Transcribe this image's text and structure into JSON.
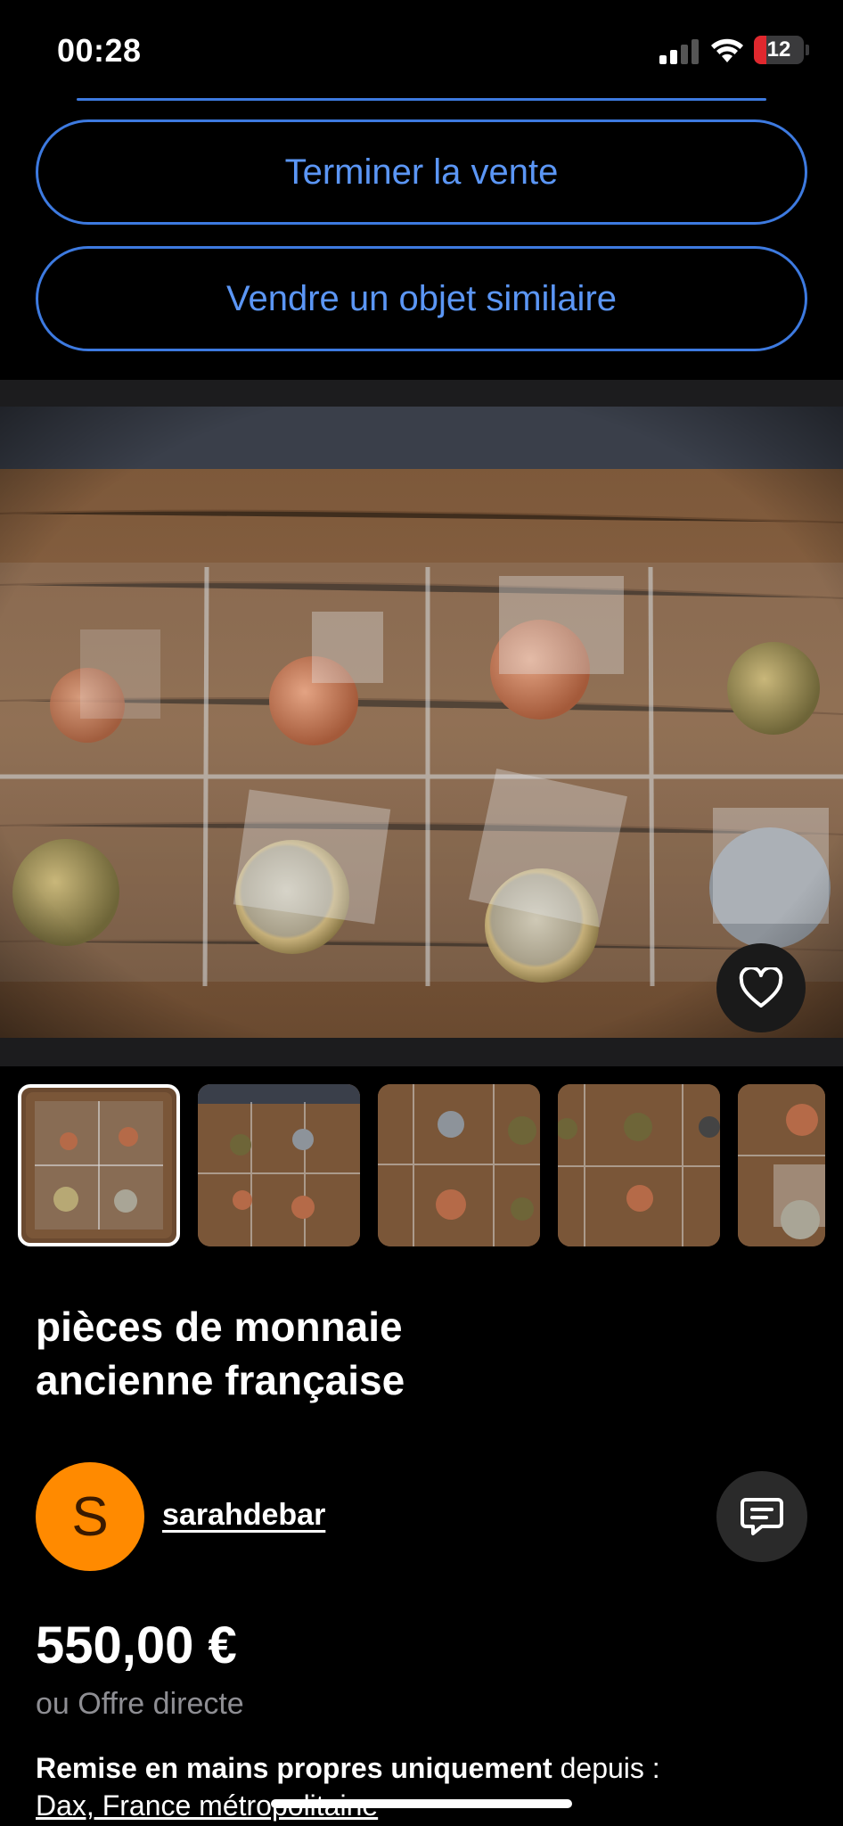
{
  "status_bar": {
    "time": "00:28",
    "battery": "12",
    "battery_level": 0.12,
    "icons": [
      "signal-icon",
      "wifi-icon",
      "battery-icon"
    ]
  },
  "actions": {
    "end_sale": "Terminer la vente",
    "sell_similar": "Vendre un objet similaire"
  },
  "listing": {
    "title_line1": "pièces de monnaie",
    "title_line2": "ancienne française",
    "thumbnails_count": 5,
    "selected_thumbnail": 1
  },
  "seller": {
    "initial": "S",
    "name": "sarahdebar",
    "avatar_color": "#ff8a00"
  },
  "price": {
    "amount": "550,00 €",
    "offer": "ou Offre directe"
  },
  "delivery": {
    "bold": "Remise en mains propres uniquement",
    "rest": " depuis :",
    "location": "Dax, France métropolitaine"
  },
  "colors": {
    "accent": "#3d7ae0",
    "background": "#000000"
  }
}
